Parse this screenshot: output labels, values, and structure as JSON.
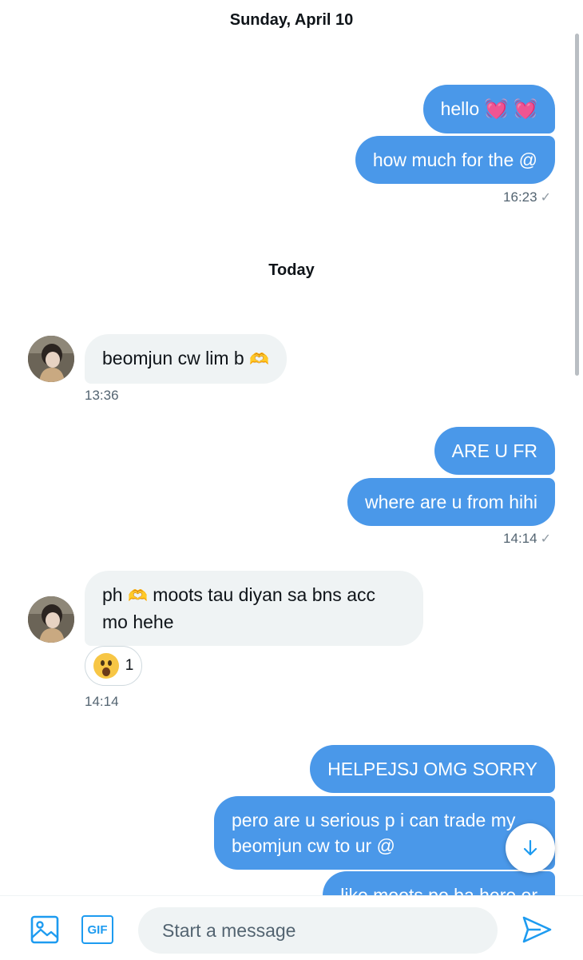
{
  "conversation": {
    "date_1": "Sunday, April 10",
    "date_2": "Today",
    "messages": [
      {
        "id": "m1",
        "direction": "outgoing",
        "text": "hello",
        "emoji": "💓 💓"
      },
      {
        "id": "m2",
        "direction": "outgoing",
        "text": "how much for the @"
      },
      {
        "id": "t1",
        "timestamp": "16:23",
        "status": "✓"
      },
      {
        "id": "m3",
        "direction": "incoming",
        "text": "beomjun cw lim b",
        "emoji": "🫶"
      },
      {
        "id": "t2",
        "timestamp": "13:36"
      },
      {
        "id": "m4",
        "direction": "outgoing",
        "text": "ARE U FR"
      },
      {
        "id": "m5",
        "direction": "outgoing",
        "text": "where are u from hihi"
      },
      {
        "id": "t3",
        "timestamp": "14:14",
        "status": "✓"
      },
      {
        "id": "m6",
        "direction": "incoming",
        "text_prefix": "ph",
        "emoji": "🫶",
        "text_suffix": "moots tau diyan sa bns acc",
        "text_line2": "mo hehe"
      },
      {
        "id": "t4",
        "timestamp": "14:14"
      },
      {
        "id": "m7",
        "direction": "outgoing",
        "text": "HELPEJSJ OMG SORRY"
      },
      {
        "id": "m8",
        "direction": "outgoing",
        "text_line1": "pero are u serious p i can trade my",
        "text_line2": "beomjun cw to ur @"
      },
      {
        "id": "m9",
        "direction": "outgoing",
        "text": "like moots po ba here or"
      }
    ],
    "reaction": {
      "emoji": "astonished-face",
      "count": "1"
    }
  },
  "composer": {
    "placeholder": "Start a message",
    "gif_label": "GIF"
  },
  "colors": {
    "outgoing_bubble": "#4a98e9",
    "incoming_bubble": "#eff3f4",
    "accent": "#1d9bf0"
  }
}
